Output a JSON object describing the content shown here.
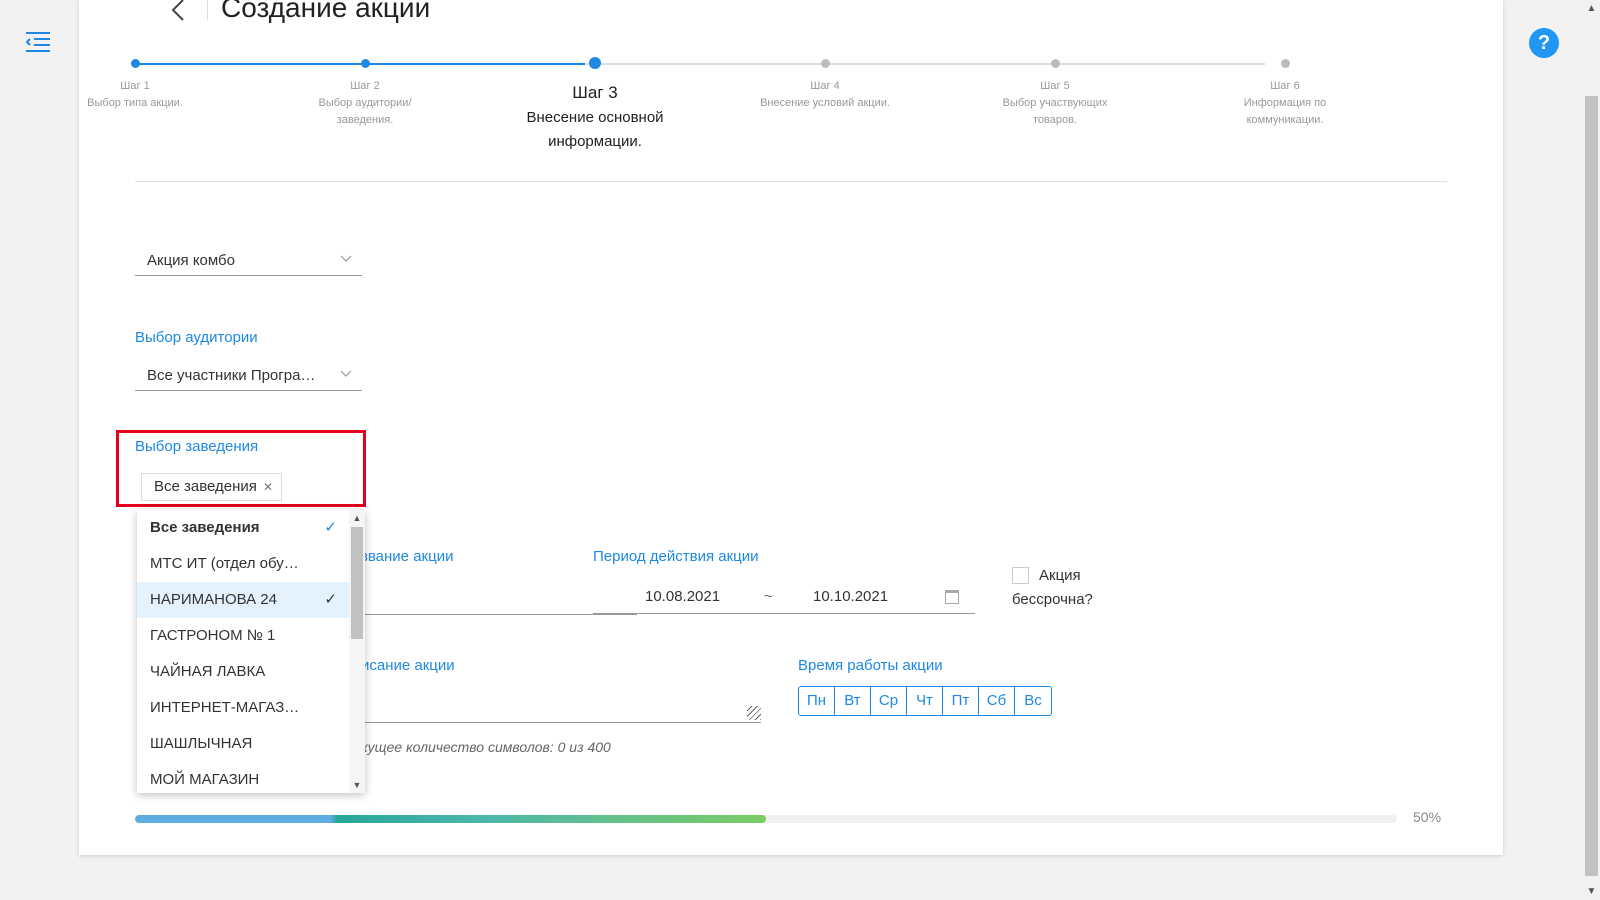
{
  "header": {
    "title": "Создание акции",
    "back_icon": "arrow-left-icon",
    "menu_icon": "menu-collapse-icon",
    "help_label": "?"
  },
  "steps": [
    {
      "num": "Шаг 1",
      "label": "Выбор типа акции.",
      "state": "done"
    },
    {
      "num": "Шаг 2",
      "label": "Выбор аудитории/заведения.",
      "state": "done"
    },
    {
      "num": "Шаг 3",
      "label": "Внесение основной информации.",
      "state": "active"
    },
    {
      "num": "Шаг 4",
      "label": "Внесение условий акции.",
      "state": "todo"
    },
    {
      "num": "Шаг 5",
      "label": "Выбор участвующих товаров.",
      "state": "todo"
    },
    {
      "num": "Шаг 6",
      "label": "Информация по коммуникации.",
      "state": "todo"
    }
  ],
  "form": {
    "promo_type": {
      "value": "Акция комбо"
    },
    "audience": {
      "label": "Выбор аудитории",
      "value": "Все участники Програ…"
    },
    "venue": {
      "label": "Выбор заведения",
      "tag": "Все заведения"
    },
    "name": {
      "label": "Название акции",
      "visible_label": "звание акции"
    },
    "period": {
      "label": "Период действия акции",
      "from": "10.08.2021",
      "separator": "~",
      "to": "10.10.2021"
    },
    "perpetual": {
      "label": "Акция бессрочна?",
      "checked": false
    },
    "description": {
      "visible_label": "исание акции",
      "counter": "кущее количество символов: 0 из 400"
    },
    "hours": {
      "label": "Время работы акции",
      "days": [
        "Пн",
        "Вт",
        "Ср",
        "Чт",
        "Пт",
        "Сб",
        "Вс"
      ]
    }
  },
  "dropdown": {
    "items": [
      {
        "label": "Все заведения",
        "checked": true,
        "bold": true,
        "selected": false
      },
      {
        "label": "МТС ИТ (отдел обу…",
        "checked": false,
        "bold": false,
        "selected": false
      },
      {
        "label": "НАРИМАНОВА 24",
        "checked": true,
        "bold": false,
        "selected": true
      },
      {
        "label": "ГАСТРОНОМ № 1",
        "checked": false,
        "bold": false,
        "selected": false
      },
      {
        "label": "ЧАЙНАЯ ЛАВКА",
        "checked": false,
        "bold": false,
        "selected": false
      },
      {
        "label": "ИНТЕРНЕТ-МАГАЗ…",
        "checked": false,
        "bold": false,
        "selected": false
      },
      {
        "label": "ШАШЛЫЧНАЯ",
        "checked": false,
        "bold": false,
        "selected": false
      },
      {
        "label": "МОЙ МАГАЗИН",
        "checked": false,
        "bold": false,
        "selected": false
      }
    ]
  },
  "progress": {
    "value": 0.5,
    "label": "50%"
  },
  "colors": {
    "accent": "#1e88e5",
    "highlight": "#e3001b",
    "help": "#2196f3"
  }
}
